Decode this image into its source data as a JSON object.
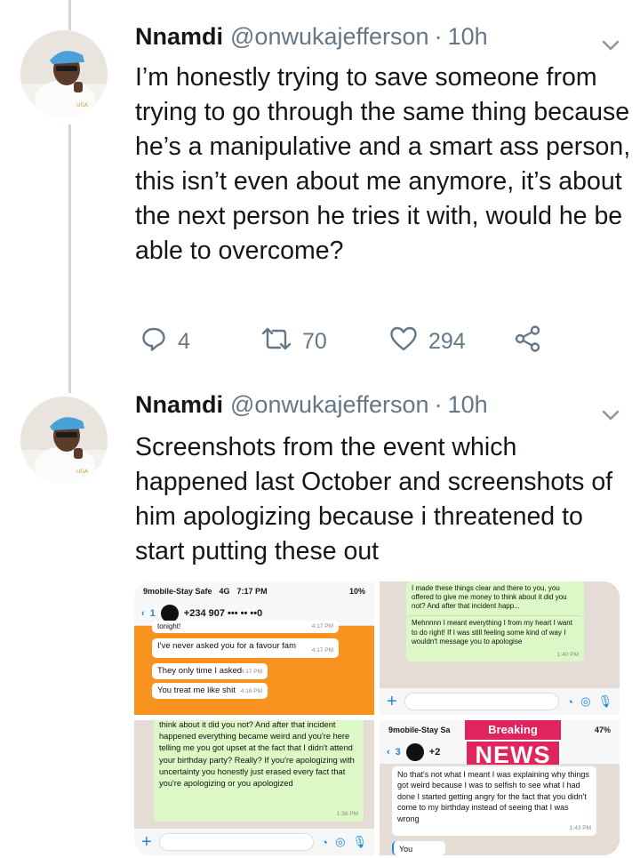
{
  "tweets": [
    {
      "display_name": "Nnamdi",
      "handle": "@onwukajefferson",
      "separator": "·",
      "time": "10h",
      "text": "I’m honestly trying to save someone from trying to go through the same thing because he’s a manipulative and a smart ass person, this isn’t even about me anymore, it’s about the next person he tries it with, would he be able to overcome?",
      "actions": {
        "replies": "4",
        "retweets": "70",
        "likes": "294"
      }
    },
    {
      "display_name": "Nnamdi",
      "handle": "@onwukajefferson",
      "separator": "·",
      "time": "10h",
      "text": "Screenshots from the event which happened last October and screenshots of him apologizing because i threatened to start putting these out"
    }
  ],
  "media": {
    "top_left": {
      "status_carrier": "9mobile-Stay Safe",
      "status_network": "4G",
      "status_time": "7:17 PM",
      "status_battery": "10%",
      "back_count": "1",
      "contact": "+234 907 ••• •• ••0",
      "partial_line": "tonight!",
      "partial_stamp": "4:17 PM",
      "msg1": "I've never asked you for a favour fam",
      "msg1_time": "4:17 PM",
      "msg2": "They only time I asked",
      "msg2_time": "4:17 PM",
      "msg3": "You treat me like shit",
      "msg3_time": "4:18 PM"
    },
    "top_right": {
      "msg1": "I made these things clear and there to you, you offered to give me money to think about it did you not? And after that incident happ...",
      "msg2": "Mehnnnn I meant everything I from my heart I want to do right! If I was still feeling some kind of way I wouldn't message you to apologise",
      "msg2_time": "1:40 PM"
    },
    "bottom_left": {
      "msg": "think about it did you not? And after that incident happened everything became weird and you're here telling me you got upset at the fact that I didn't attend your birthday party? Really? If you're apologizing with uncertainty you honestly just erased every fact that you're apologizing or you apologized",
      "msg_time": "1:38 PM"
    },
    "bottom_right": {
      "status_carrier": "9mobile-Stay Sa",
      "status_battery": "47%",
      "back_count": "3",
      "contact_prefix": "+2",
      "overlay_top": "Breaking",
      "overlay_main": "NEWS",
      "msg1": "No that's not what I meant I was explaining why things got weird because I was to selfish to see what I had done I started getting angry for the fact that you didn't come to my birthday instead of seeing that I was wrong",
      "msg1_time": "1:43 PM",
      "msg2": "You"
    }
  },
  "colors": {
    "text": "#14171a",
    "secondary": "#657786",
    "thread": "#ccd6dd",
    "news": "#e0245e",
    "wa_green": "#dcf8c6",
    "wa_bg": "#e5ddd5"
  }
}
